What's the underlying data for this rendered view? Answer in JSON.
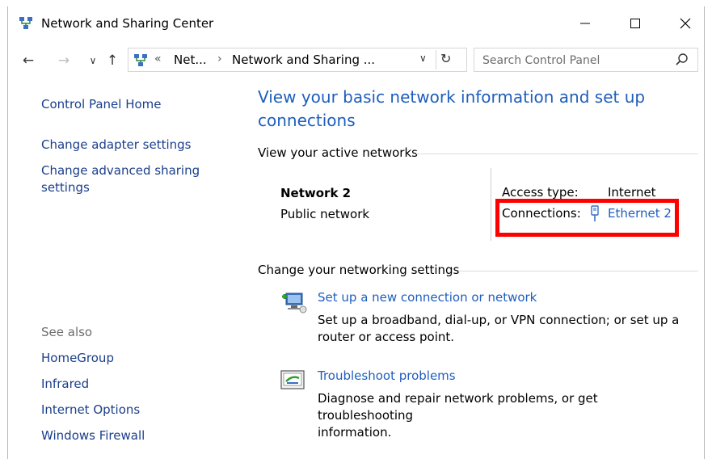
{
  "window": {
    "title": "Network and Sharing Center"
  },
  "nav": {
    "back": "←",
    "forward": "→",
    "recent": "∨",
    "up": "↑",
    "address_prefix": "«",
    "address_seg1": "Net...",
    "address_sep": "›",
    "address_seg2": "Network and Sharing ...",
    "dropdown": "∨",
    "refresh": "↻",
    "search_placeholder": "Search Control Panel"
  },
  "sidebar": {
    "links": [
      "Control Panel Home",
      "Change adapter settings",
      "Change advanced sharing",
      "settings"
    ],
    "see_also_heading": "See also",
    "see_also": [
      "HomeGroup",
      "Infrared",
      "Internet Options",
      "Windows Firewall"
    ]
  },
  "main": {
    "title_line1": "View your basic network information and set up",
    "title_line2": "connections",
    "active_networks_heading": "View your active networks",
    "network": {
      "name": "Network  2",
      "category": "Public network",
      "access_type_label": "Access type:",
      "access_type_value": "Internet",
      "connections_label": "Connections:",
      "connections_value": "Ethernet 2"
    },
    "settings_heading": "Change your networking settings",
    "tasks": [
      {
        "icon": "new-connection-icon",
        "link": "Set up a new connection or network",
        "desc_line1": "Set up a broadband, dial-up, or VPN connection; or set up a",
        "desc_line2": "router or access point."
      },
      {
        "icon": "troubleshoot-icon",
        "link": "Troubleshoot problems",
        "desc_line1": "Diagnose and repair network problems, or get troubleshooting",
        "desc_line2": "information."
      }
    ]
  },
  "colors": {
    "link": "#1e5ebd",
    "side_link": "#1a3e8c",
    "highlight": "#ff0000"
  }
}
